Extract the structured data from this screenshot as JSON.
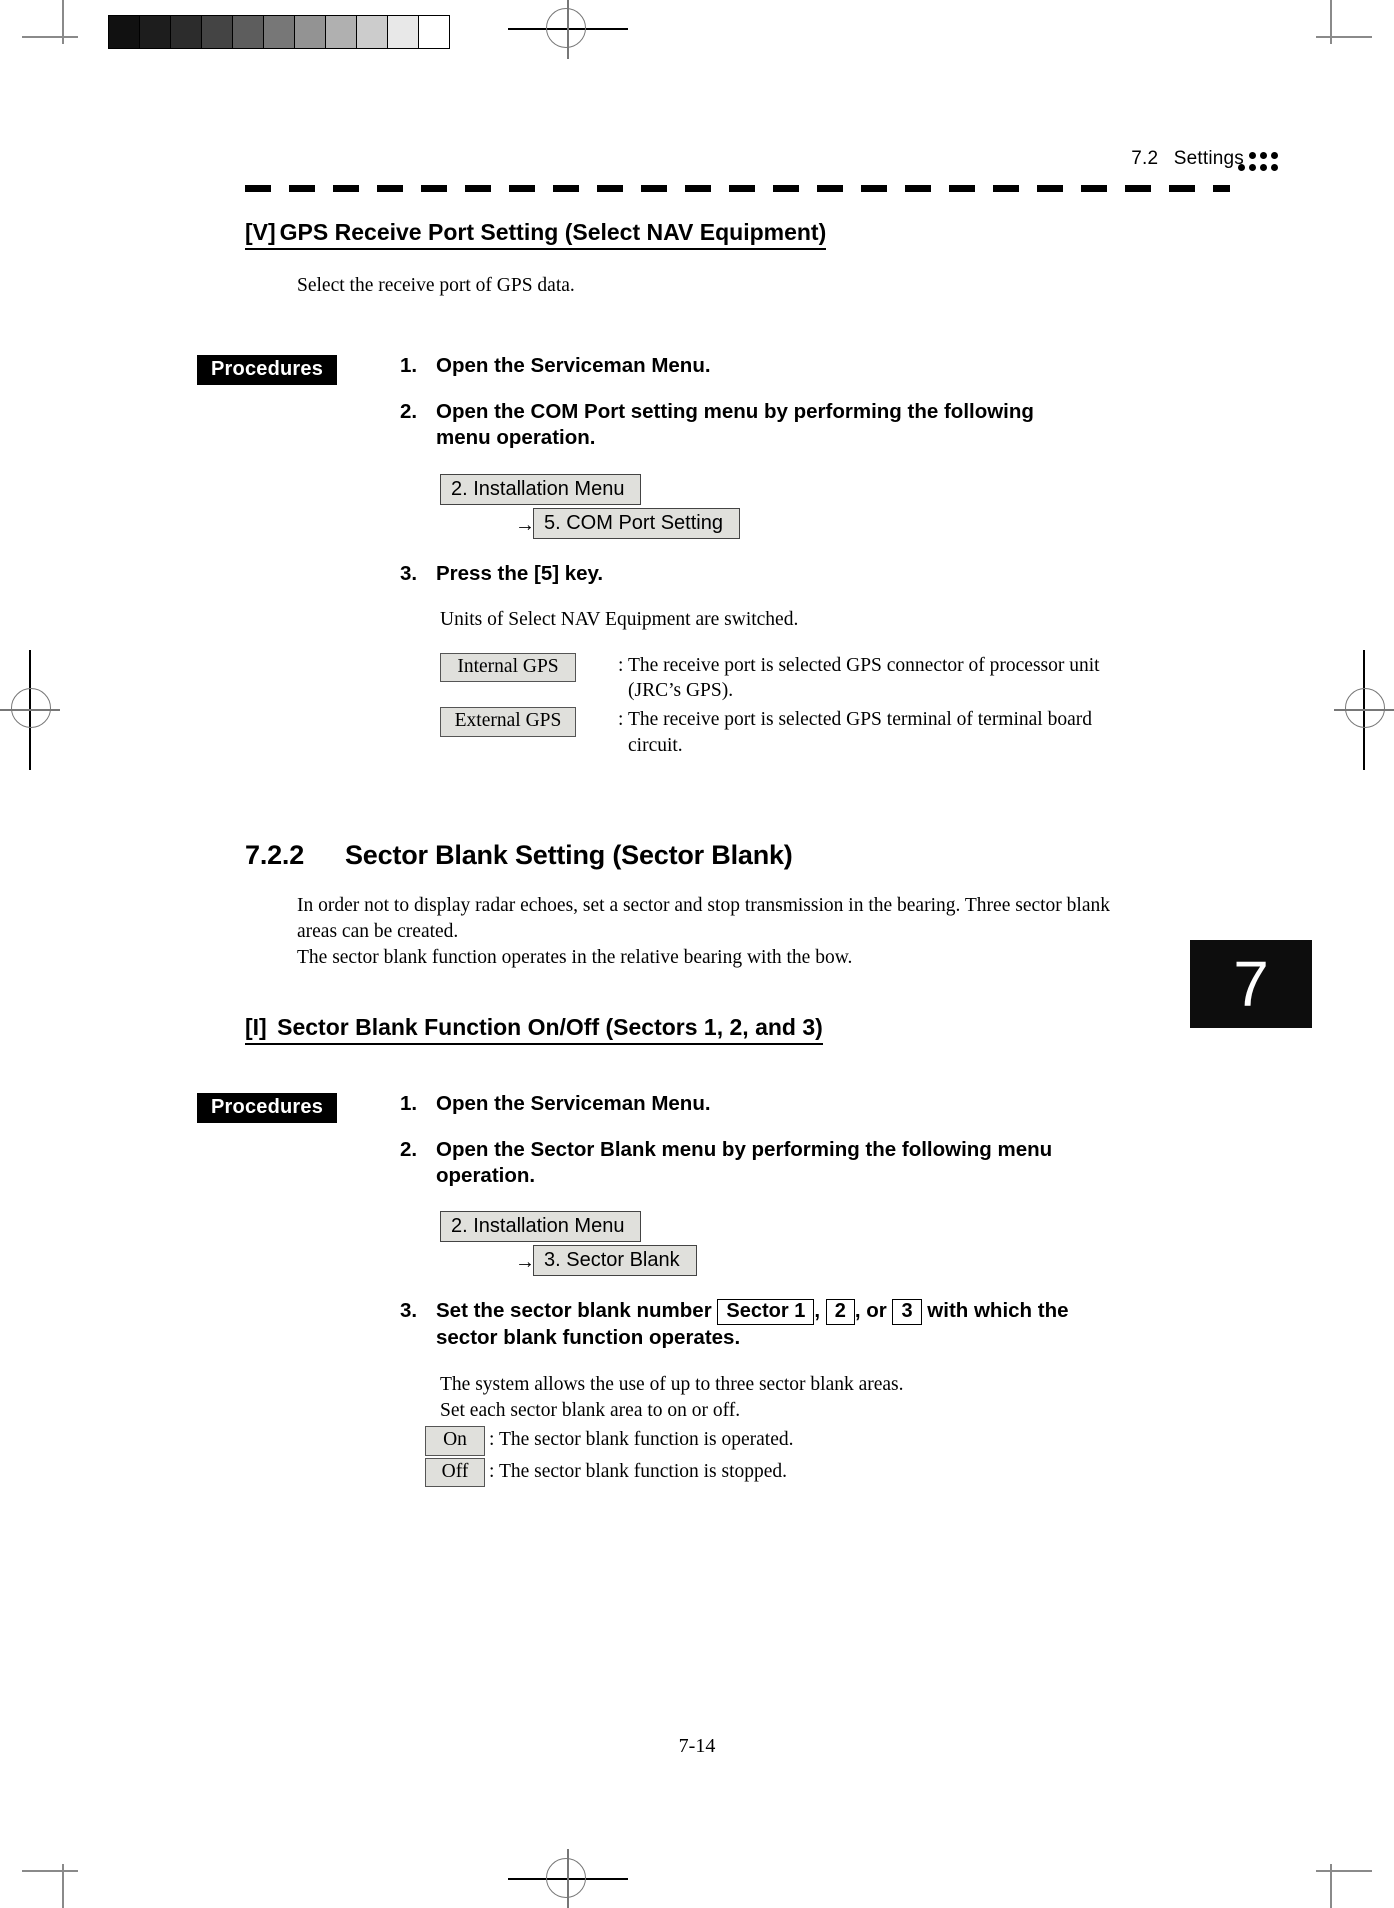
{
  "document": {
    "page_number": "7-14",
    "chapter_tab": "7",
    "header": {
      "section_number": "7.2",
      "section_title": "Settings",
      "dot_matrix": {
        "top_row_dots": 3,
        "bottom_row_dots": 4
      }
    },
    "scan_calibration": {
      "grayscale_steps": [
        "#111111",
        "#1d1d1d",
        "#2c2c2c",
        "#444444",
        "#5d5d5d",
        "#777777",
        "#939393",
        "#b0b0b0",
        "#cccccc",
        "#e8e8e8",
        "#ffffff"
      ]
    }
  },
  "sections": {
    "gps_port": {
      "heading_tag": "[V]",
      "heading_title": "GPS Receive Port Setting (Select NAV Equipment)",
      "intro": "Select the receive port of GPS data.",
      "procedures_label": "Procedures",
      "steps": [
        {
          "num": "1.",
          "text": "Open the Serviceman Menu."
        },
        {
          "num": "2.",
          "text": "Open the COM Port setting menu by performing the following menu operation."
        },
        {
          "num": "3.",
          "text": "Press the [5] key."
        }
      ],
      "menu_path": {
        "level1": "2. Installation Menu",
        "arrow": "→",
        "level2": "5. COM Port Setting"
      },
      "switch_note": "Units of Select NAV Equipment are switched.",
      "options": [
        {
          "key": "Internal GPS",
          "desc": ": The receive port is selected GPS connector of processor unit",
          "desc_cont": "(JRC’s GPS)."
        },
        {
          "key": "External GPS",
          "desc": ": The receive port is selected GPS terminal of terminal board",
          "desc_cont": "circuit."
        }
      ]
    },
    "sector_blank": {
      "heading_number": "7.2.2",
      "heading_title": "Sector Blank Setting (Sector Blank)",
      "intro_line1": "In order not to display radar echoes, set a sector and stop transmission in the bearing.    Three sector blank",
      "intro_line2": "areas can be created.",
      "intro_line3": "The sector blank function operates in the relative bearing with the bow.",
      "sub_heading_tag": "[I]",
      "sub_heading_title": "Sector Blank Function On/Off (Sectors 1, 2, and 3)",
      "procedures_label": "Procedures",
      "steps": [
        {
          "num": "1.",
          "text": "Open the Serviceman Menu."
        },
        {
          "num": "2.",
          "text": "Open the Sector Blank menu by performing the following menu operation."
        }
      ],
      "menu_path": {
        "level1": "2. Installation Menu",
        "arrow": "→",
        "level2": "3. Sector Blank"
      },
      "step3": {
        "num": "3.",
        "part1": "Set the sector blank number",
        "key1": "Sector 1",
        "sep1": ",",
        "key2": "2",
        "sep2": ", or",
        "key3": "3",
        "part2": "with which the",
        "line2": "sector blank function operates."
      },
      "notes": {
        "line1": "The system allows the use of up to three sector blank areas.",
        "line2": "Set each sector blank area to on or off."
      },
      "on_off": [
        {
          "key": "On",
          "desc": ": The sector blank function is operated."
        },
        {
          "key": "Off",
          "desc": ": The sector blank function is stopped."
        }
      ]
    }
  }
}
